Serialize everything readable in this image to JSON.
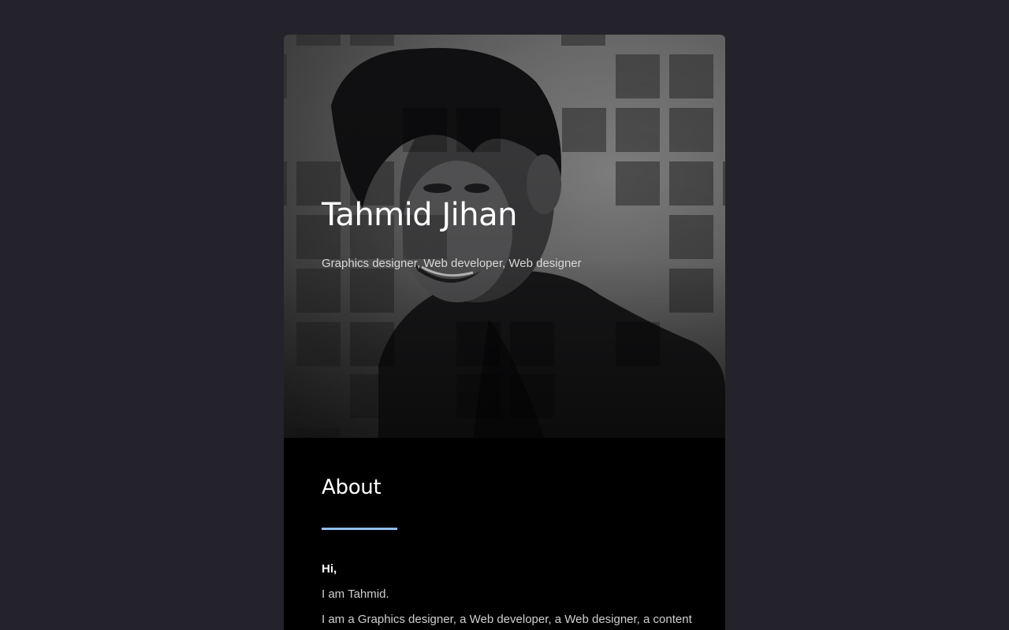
{
  "profile": {
    "name": "Tahmid Jihan",
    "roles": "Graphics designer, Web developer, Web designer"
  },
  "about": {
    "heading": "About",
    "greeting": "Hi,",
    "line1": "I am Tahmid.",
    "line2": "I am a Graphics designer, a Web developer, a Web designer, a content"
  },
  "colors": {
    "page_background": "#24232b",
    "card_background": "#000000",
    "accent": "#8fbff0"
  }
}
